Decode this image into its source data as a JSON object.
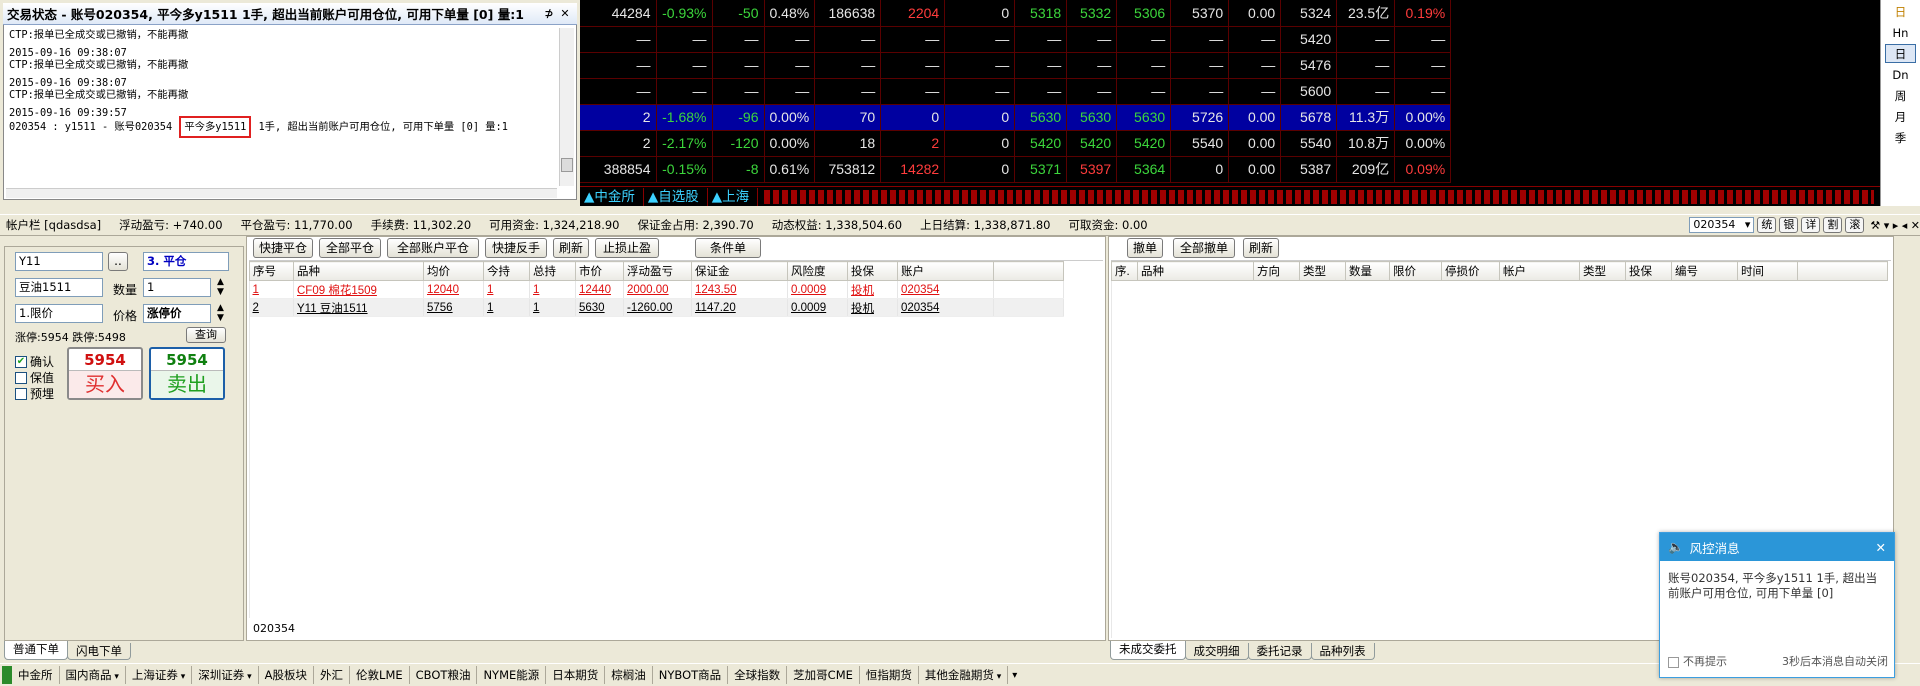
{
  "msgwin": {
    "title": "交易状态 - 账号020354, 平今多y1511 1手, 超出当前账户可用仓位, 可用下单量 [0] 量:1",
    "pin": "⊅",
    "close": "✕",
    "lines": [
      "CTP:报单已全成交或已撤销，不能再撤",
      "2015-09-16 09:38:07",
      "CTP:报单已全成交或已撤销，不能再撤",
      "2015-09-16 09:38:07",
      "CTP:报单已全成交或已撤销，不能再撤",
      "2015-09-16 09:39:57"
    ],
    "last_pre": "020354 : y1511 - 账号020354 ",
    "last_hl": "平今多y1511",
    "last_post": " 1手, 超出当前账户可用仓位, 可用下单量 [0] 量:1"
  },
  "quote": {
    "rows": [
      [
        "44284",
        "-0.93%",
        "-50",
        "0.48%",
        "186638",
        "2204",
        "0",
        "5318",
        "5332",
        "5306",
        "5370",
        "0.00",
        "5324",
        "23.5亿",
        "0.19%"
      ],
      [
        "—",
        "—",
        "—",
        "—",
        "—",
        "—",
        "—",
        "—",
        "—",
        "—",
        "—",
        "—",
        "5420",
        "—",
        "—"
      ],
      [
        "—",
        "—",
        "—",
        "—",
        "—",
        "—",
        "—",
        "—",
        "—",
        "—",
        "—",
        "—",
        "5476",
        "—",
        "—"
      ],
      [
        "—",
        "—",
        "—",
        "—",
        "—",
        "—",
        "—",
        "—",
        "—",
        "—",
        "—",
        "—",
        "5600",
        "—",
        "—"
      ],
      [
        "2",
        "-1.68%",
        "-96",
        "0.00%",
        "70",
        "0",
        "0",
        "5630",
        "5630",
        "5630",
        "5726",
        "0.00",
        "5678",
        "11.3万",
        "0.00%"
      ],
      [
        "2",
        "-2.17%",
        "-120",
        "0.00%",
        "18",
        "2",
        "0",
        "5420",
        "5420",
        "5420",
        "5540",
        "0.00",
        "5540",
        "10.8万",
        "0.00%"
      ],
      [
        "388854",
        "-0.15%",
        "-8",
        "0.61%",
        "753812",
        "14282",
        "0",
        "5371",
        "5397",
        "5364",
        "0",
        "0.00",
        "5387",
        "209亿",
        "0.09%"
      ]
    ],
    "colors": [
      [
        "w",
        "g",
        "g",
        "w",
        "w",
        "r",
        "w",
        "g",
        "g",
        "g",
        "w",
        "w",
        "w",
        "w",
        "r"
      ],
      [
        "w",
        "w",
        "w",
        "w",
        "w",
        "w",
        "w",
        "w",
        "w",
        "w",
        "w",
        "w",
        "w",
        "w",
        "w"
      ],
      [
        "w",
        "w",
        "w",
        "w",
        "w",
        "w",
        "w",
        "w",
        "w",
        "w",
        "w",
        "w",
        "w",
        "w",
        "w"
      ],
      [
        "w",
        "w",
        "w",
        "w",
        "w",
        "w",
        "w",
        "w",
        "w",
        "w",
        "w",
        "w",
        "w",
        "w",
        "w"
      ],
      [
        "w",
        "g",
        "g",
        "w",
        "w",
        "w",
        "w",
        "g",
        "g",
        "g",
        "w",
        "w",
        "w",
        "w",
        "w"
      ],
      [
        "w",
        "g",
        "g",
        "w",
        "w",
        "r",
        "w",
        "g",
        "g",
        "g",
        "w",
        "w",
        "w",
        "w",
        "w"
      ],
      [
        "w",
        "g",
        "g",
        "w",
        "w",
        "r",
        "w",
        "g",
        "r",
        "g",
        "w",
        "w",
        "w",
        "w",
        "r"
      ]
    ],
    "tabs": [
      "▲中金所",
      "▲自选股",
      "▲上海"
    ]
  },
  "rightbar": [
    "日",
    "Hn",
    "日",
    "Dn",
    "周",
    "月",
    "季"
  ],
  "accbar": {
    "items": [
      "帐户栏 [qdasdsa]",
      "浮动盈亏: +740.00",
      "平仓盈亏: 11,770.00",
      "手续费: 11,302.20",
      "可用资金: 1,324,218.90",
      "保证金占用: 2,390.70",
      "动态权益: 1,338,504.60",
      "上日结算: 1,338,871.80",
      "可取资金: 0.00"
    ],
    "account_select": "020354",
    "round_buttons": [
      "统",
      "银",
      "详",
      "割",
      "滚"
    ],
    "controls": "⚒ ▾ ▸ ◂ ✕"
  },
  "order": {
    "code": "Y11",
    "browse": "..",
    "action": "3. 平仓",
    "name": "豆油1511",
    "qty_label": "数量",
    "qty": "1",
    "price_type": "1.限价",
    "price_label": "价格",
    "price": "涨停价",
    "limit_text": "涨停:5954 跌停:5498",
    "query": "查询",
    "confirm": "确认",
    "hedge": "保值",
    "preorder": "预埋",
    "buy_price": "5954",
    "buy_label": "买入",
    "sell_price": "5954",
    "sell_label": "卖出"
  },
  "positions": {
    "buttons": [
      "快捷平仓",
      "全部平仓",
      "全部账户平仓",
      "快捷反手",
      "刷新",
      "止损止盈",
      "条件单"
    ],
    "headers": [
      "序号",
      "品种",
      "均价",
      "今持",
      "总持",
      "市价",
      "浮动盈亏",
      "保证金",
      "风险度",
      "投保",
      "账户"
    ],
    "rows": [
      [
        "1",
        "CF09 棉花1509",
        "12040",
        "1",
        "1",
        "12440",
        "2000.00",
        "1243.50",
        "0.0009",
        "投机",
        "020354"
      ],
      [
        "2",
        "Y11 豆油1511",
        "5756",
        "1",
        "1",
        "5630",
        "-1260.00",
        "1147.20",
        "0.0009",
        "投机",
        "020354"
      ]
    ],
    "footer": "020354"
  },
  "orders": {
    "buttons": [
      "撤单",
      "全部撤单",
      "刷新"
    ],
    "headers": [
      "序.",
      "品种",
      "方向",
      "类型",
      "数量",
      "限价",
      "停损价",
      "帐户",
      "类型",
      "投保",
      "编号",
      "时间"
    ]
  },
  "left_tabs": [
    "普通下单",
    "闪电下单"
  ],
  "right_tabs": [
    "未成交委托",
    "成交明细",
    "委托记录",
    "品种列表"
  ],
  "market_menu": [
    "中金所",
    "国内商品",
    "上海证券",
    "深圳证券",
    "A股板块",
    "外汇",
    "伦敦LME",
    "CBOT粮油",
    "NYME能源",
    "日本期货",
    "棕榈油",
    "NYBOT商品",
    "全球指数",
    "芝加哥CME",
    "恒指期货",
    "其他金融期货"
  ],
  "market_dd": [
    false,
    true,
    true,
    true,
    false,
    false,
    false,
    false,
    false,
    false,
    false,
    false,
    false,
    false,
    false,
    true
  ],
  "popup": {
    "title": "风控消息",
    "body": "账号020354, 平今多y1511 1手, 超出当前账户可用仓位, 可用下单量 [0]",
    "dont_show": "不再提示",
    "auto_close": "3秒后本消息自动关闭"
  }
}
